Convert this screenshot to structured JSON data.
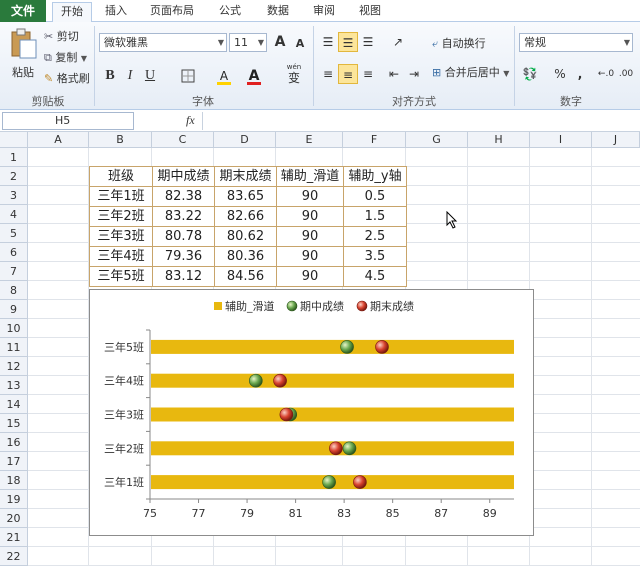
{
  "ribbon_tabs": [
    "文件",
    "开始",
    "插入",
    "页面布局",
    "公式",
    "数据",
    "审阅",
    "视图"
  ],
  "clipboard": {
    "paste": "粘贴",
    "cut": "剪切",
    "copy": "复制",
    "format_painter": "格式刷",
    "label": "剪贴板"
  },
  "font": {
    "name": "微软雅黑",
    "size": "11",
    "grow": "A",
    "shrink": "A",
    "bold": "B",
    "italic": "I",
    "underline": "U",
    "fill": "A",
    "color": "A",
    "wen": "wén",
    "wen_char": "变",
    "label": "字体"
  },
  "alignment": {
    "wrap": "自动换行",
    "merge": "合并后居中",
    "label": "对齐方式"
  },
  "number": {
    "format": "常规",
    "percent": "%",
    "comma": ",",
    "label": "数字"
  },
  "formula_bar": {
    "name_box": "H5",
    "fx": "fx"
  },
  "columns": [
    "A",
    "B",
    "C",
    "D",
    "E",
    "F",
    "G",
    "H",
    "I",
    "J"
  ],
  "rows": [
    "1",
    "2",
    "3",
    "4",
    "5",
    "6",
    "7",
    "8",
    "9",
    "10",
    "11",
    "12",
    "13",
    "14",
    "15",
    "16",
    "17",
    "18",
    "19",
    "20",
    "21",
    "22"
  ],
  "table": {
    "headers": [
      "班级",
      "期中成绩",
      "期末成绩",
      "辅助_滑道",
      "辅助_y轴"
    ],
    "rows": [
      [
        "三年1班",
        "82.38",
        "83.65",
        "90",
        "0.5"
      ],
      [
        "三年2班",
        "83.22",
        "82.66",
        "90",
        "1.5"
      ],
      [
        "三年3班",
        "80.78",
        "80.62",
        "90",
        "2.5"
      ],
      [
        "三年4班",
        "79.36",
        "80.36",
        "90",
        "3.5"
      ],
      [
        "三年5班",
        "83.12",
        "84.56",
        "90",
        "4.5"
      ]
    ]
  },
  "chart_data": {
    "type": "bar",
    "legend": [
      "辅助_滑道",
      "期中成绩",
      "期末成绩"
    ],
    "legend_position": "top",
    "categories": [
      "三年1班",
      "三年2班",
      "三年3班",
      "三年4班",
      "三年5班"
    ],
    "series": [
      {
        "name": "辅助_滑道",
        "values": [
          90,
          90,
          90,
          90,
          90
        ]
      },
      {
        "name": "期中成绩",
        "values": [
          82.38,
          83.22,
          80.78,
          79.36,
          83.12
        ]
      },
      {
        "name": "期末成绩",
        "values": [
          83.65,
          82.66,
          80.62,
          80.36,
          84.56
        ]
      }
    ],
    "xlim": [
      75,
      90
    ],
    "xticks": [
      "75",
      "77",
      "79",
      "81",
      "83",
      "85",
      "87",
      "89"
    ],
    "grid": false,
    "colors": {
      "bar": "#e8b80f",
      "mid": "#6aa84f",
      "final": "#d9432f"
    }
  }
}
